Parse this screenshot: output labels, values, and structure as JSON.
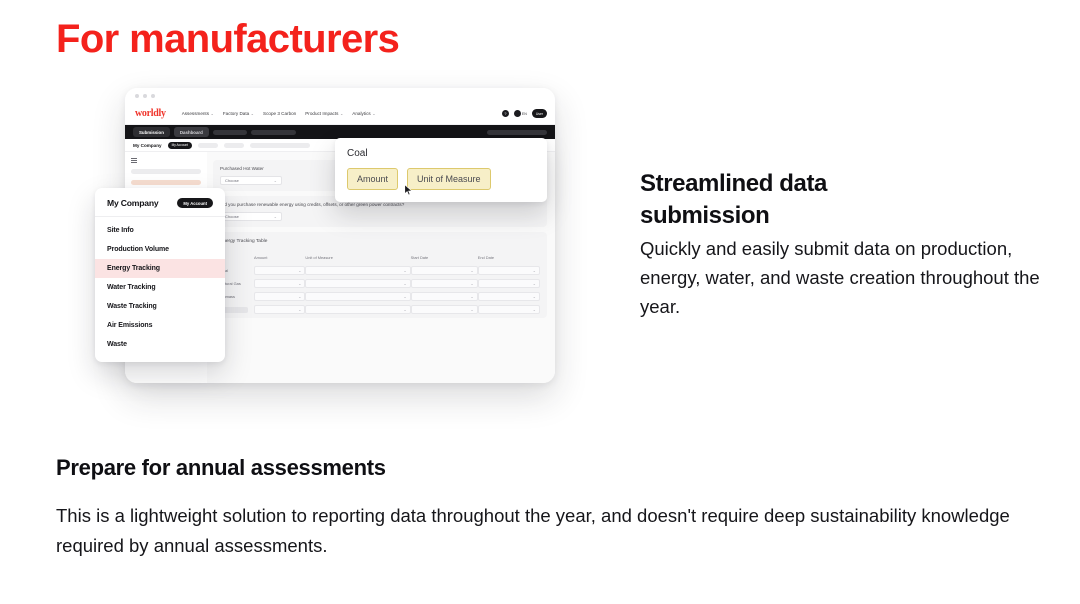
{
  "headline": "For manufacturers",
  "mockup": {
    "browser": {
      "brand": "worldly",
      "nav_links": [
        {
          "label": "Assessments",
          "caret": "⌄"
        },
        {
          "label": "Factory Data",
          "caret": "⌄"
        },
        {
          "label": "Scope 3 Carbon",
          "caret": ""
        },
        {
          "label": "Product Impacts",
          "caret": "⌄"
        },
        {
          "label": "Analytics",
          "caret": "⌄"
        }
      ],
      "help_icon": "?",
      "language_label": "EN",
      "avatar_label": "User",
      "tabs": [
        {
          "label": "Submission",
          "active": true
        },
        {
          "label": "Dashboard",
          "active": false
        }
      ],
      "subbar": {
        "company": "My Company",
        "account_badge": "My Account"
      }
    },
    "form": {
      "field1_label": "Purchased Hot Water",
      "field1_value": "Choose",
      "field2_label": "Did you purchase renewable energy using credits, offsets, or other green power contracts?",
      "field2_value": "Choose",
      "table_title": "Energy Tracking Table",
      "table_columns": [
        "Amount",
        "Unit of Measure",
        "Start Date",
        "End Date"
      ],
      "table_rows": [
        "Coal",
        "Natural Gas",
        "Biomass"
      ]
    },
    "sidebar": {
      "title": "My Company",
      "account_badge": "My Account",
      "items": [
        {
          "label": "Site Info",
          "active": false
        },
        {
          "label": "Production Volume",
          "active": false
        },
        {
          "label": "Energy Tracking",
          "active": true
        },
        {
          "label": "Water Tracking",
          "active": false
        },
        {
          "label": "Waste Tracking",
          "active": false
        },
        {
          "label": "Air Emissions",
          "active": false
        },
        {
          "label": "Waste",
          "active": false
        }
      ]
    },
    "popup": {
      "title": "Coal",
      "field_amount": "Amount",
      "field_unit": "Unit of Measure"
    }
  },
  "feature": {
    "title_line1": "Streamlined data",
    "title_line2": "submission",
    "body": "Quickly and easily submit data on production, energy, water, and waste creation throughout the year."
  },
  "bottom": {
    "title": "Prepare for annual assessments",
    "body": "This is a lightweight solution to reporting data throughout the year, and doesn't require deep sustainability knowledge required by annual assessments."
  },
  "colors": {
    "brand_red": "#f4221c",
    "highlight_pink": "#fbe3e3",
    "field_yellow": "#f7efc8",
    "field_yellow_border": "#ddc96d",
    "dark": "#141417"
  }
}
